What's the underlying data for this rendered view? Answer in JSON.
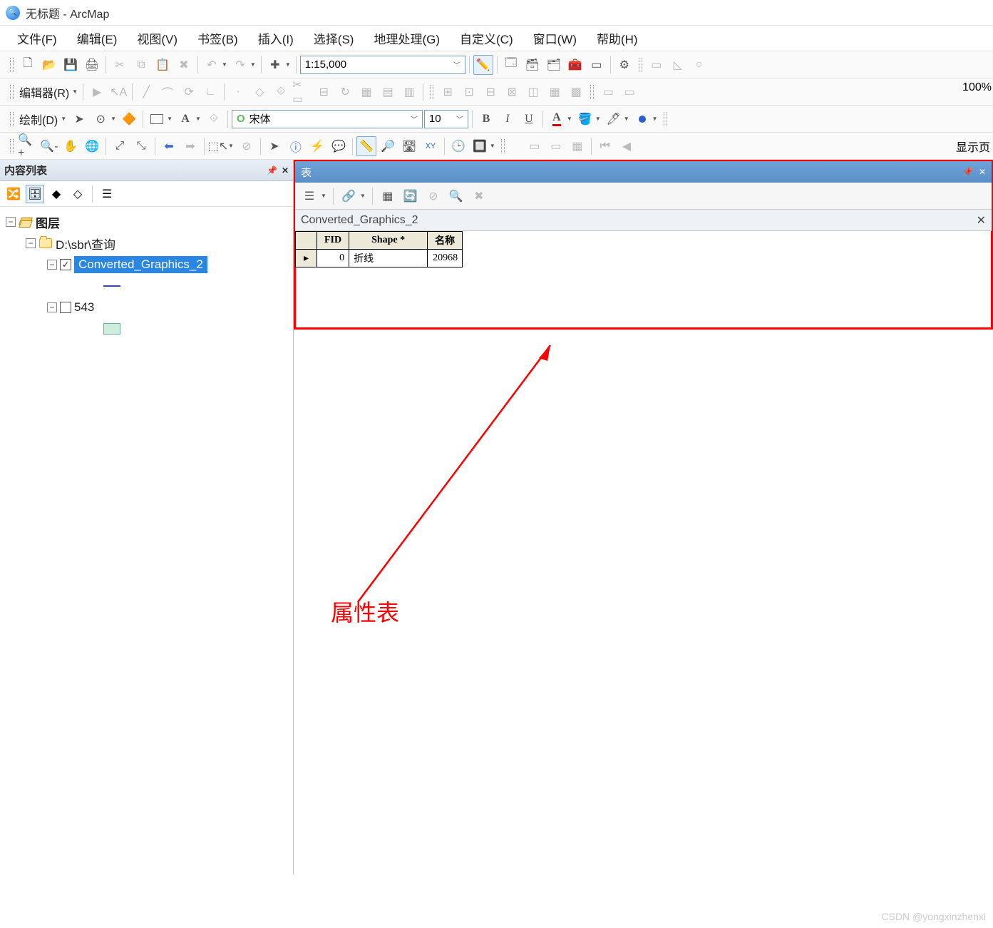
{
  "app": {
    "title": "无标题 - ArcMap"
  },
  "menu": {
    "file": "文件(F)",
    "edit": "编辑(E)",
    "view": "视图(V)",
    "bookmark": "书签(B)",
    "insert": "插入(I)",
    "select": "选择(S)",
    "geoproc": "地理处理(G)",
    "custom": "自定义(C)",
    "window": "窗口(W)",
    "help": "帮助(H)"
  },
  "toolbar1": {
    "scale": "1:15,000"
  },
  "toolbar2": {
    "editor": "编辑器(R)",
    "zoom": "100%"
  },
  "toolbar3": {
    "draw": "绘制(D)",
    "font": "宋体",
    "fontsize": "10",
    "bold": "B",
    "italic": "I",
    "underline": "U"
  },
  "toolbar4": {
    "showpage": "显示页"
  },
  "toc": {
    "title": "内容列表",
    "root": "图层",
    "folder": "D:\\sbr\\查询",
    "layer1": "Converted_Graphics_2",
    "layer2": "543"
  },
  "table": {
    "title": "表",
    "name": "Converted_Graphics_2",
    "cols": {
      "fid": "FID",
      "shape": "Shape *",
      "name": "名称"
    },
    "row": {
      "fid": "0",
      "shape": "折线",
      "name": "20968"
    }
  },
  "annotation": {
    "label": "属性表"
  },
  "watermark": "CSDN @yongxinzhenxi"
}
